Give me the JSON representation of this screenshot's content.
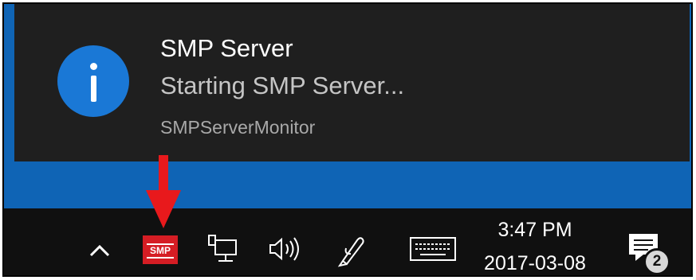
{
  "notification": {
    "title": "SMP Server",
    "message": "Starting SMP Server...",
    "source_app": "SMPServerMonitor",
    "icon": "info-icon"
  },
  "taskbar": {
    "tray_icons": [
      {
        "name": "show-hidden-icons",
        "icon": "chevron-up-icon"
      },
      {
        "name": "smp-server-monitor",
        "icon": "smp-app-icon",
        "label": "SMP"
      },
      {
        "name": "network",
        "icon": "network-icon"
      },
      {
        "name": "volume",
        "icon": "volume-icon"
      },
      {
        "name": "pen-workspace",
        "icon": "pen-icon"
      },
      {
        "name": "touch-keyboard",
        "icon": "keyboard-icon"
      }
    ],
    "clock": {
      "time": "3:47 PM",
      "date": "2017-03-08"
    },
    "action_center": {
      "icon": "notifications-icon",
      "badge_count": "2"
    }
  },
  "annotation": {
    "icon": "red-arrow-down-icon",
    "color": "#e8191c"
  },
  "colors": {
    "toast_bg": "#1f1f1f",
    "desktop_blue": "#0f64b5",
    "info_blue": "#1a78d6",
    "taskbar_bg": "#101010",
    "smp_red": "#d51d24"
  }
}
